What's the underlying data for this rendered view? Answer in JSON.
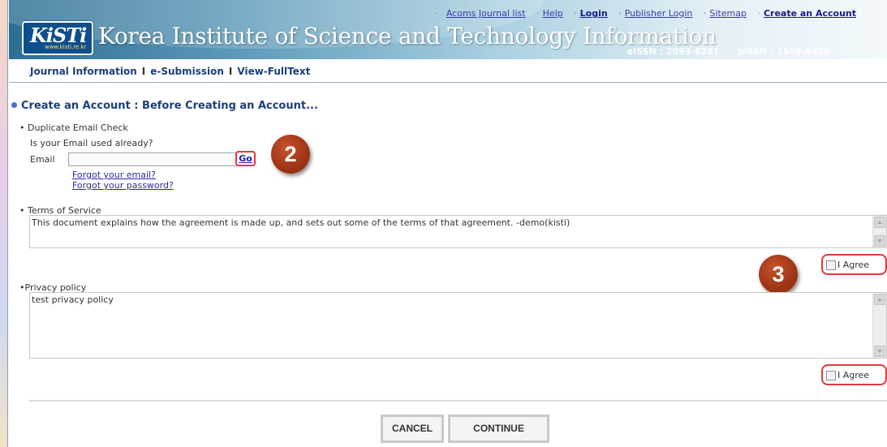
{
  "header": {
    "top_links": [
      "Acoms Journal list",
      "Help",
      "Login",
      "Publisher Login",
      "Sitemap",
      "Create an Account"
    ],
    "logo_text": "KiSTi",
    "logo_sub": "www.kisti.re.kr",
    "site_title": "Korea Institute of Science and Technology Information",
    "eissn": "eISSN : 2093-6281",
    "pissn": "pISSN : 1598-9429"
  },
  "nav": {
    "items": [
      "Journal Information",
      "e-Submission",
      "View-FullText"
    ],
    "separator": "I"
  },
  "page": {
    "heading": "Create an Account : Before Creating an Account..."
  },
  "email_check": {
    "section_title": "Duplicate Email Check",
    "question": "Is your Email used already?",
    "email_label": "Email",
    "email_value": "",
    "go_label": "Go",
    "forgot_email": "Forgot your email?",
    "forgot_password": "Forgot your password?"
  },
  "terms": {
    "section_title": "Terms of Service",
    "text": "This document explains how the agreement is made up, and sets out some of the terms of that agreement.  -demo(kisti)",
    "agree_label": "I Agree",
    "agree_checked": false
  },
  "privacy": {
    "section_title": "Privacy policy",
    "text": "test privacy policy",
    "agree_label": "I Agree",
    "agree_checked": false
  },
  "buttons": {
    "cancel": "CANCEL",
    "continue": "CONTINUE"
  },
  "annotations": {
    "badge_2": "2",
    "badge_3": "3",
    "color": "#a63a19",
    "highlight_color": "#e23a3a"
  },
  "colors": {
    "nav_text": "#1c3f7a",
    "link": "#2a2aa6",
    "header_start": "#2d6e94"
  }
}
